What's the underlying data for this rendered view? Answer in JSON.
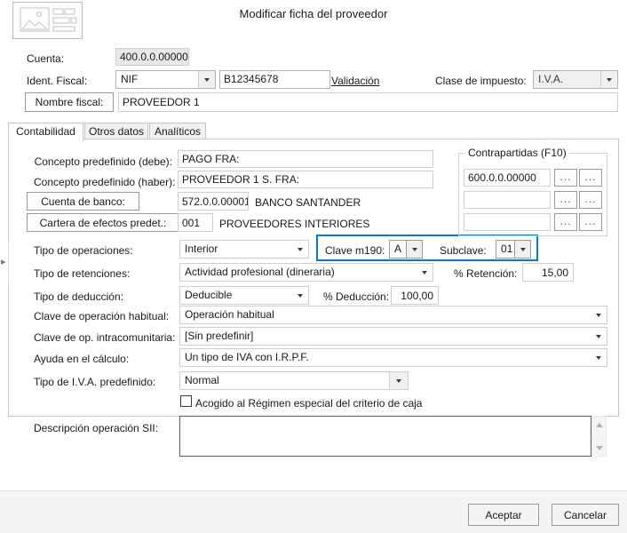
{
  "dialog": {
    "title": "Modificar ficha del proveedor",
    "header_icon": "image-placeholder-icon"
  },
  "header": {
    "cuenta_label": "Cuenta:",
    "cuenta_value": "400.0.0.00000",
    "ident_fiscal_label": "Ident. Fiscal:",
    "ident_fiscal_type": "NIF",
    "ident_fiscal_number": "B12345678",
    "validacion_link": "Validación",
    "clase_impuesto_label": "Clase de impuesto:",
    "clase_impuesto_value": "I.V.A.",
    "nombre_fiscal_button": "Nombre fiscal:",
    "nombre_fiscal_value": "PROVEEDOR 1"
  },
  "tabs": [
    {
      "label": "Contabilidad",
      "selected": true
    },
    {
      "label": "Otros datos",
      "selected": false
    },
    {
      "label": "Analíticos",
      "selected": false
    }
  ],
  "contabilidad": {
    "concepto_debe_label": "Concepto predefinido (debe):",
    "concepto_debe_value": "PAGO FRA:",
    "concepto_haber_label": "Concepto predefinido (haber):",
    "concepto_haber_value": "PROVEEDOR 1 S. FRA:",
    "cuenta_banco_button": "Cuenta de banco:",
    "cuenta_banco_code": "572.0.0.00001",
    "cuenta_banco_name": "BANCO SANTANDER",
    "cartera_button": "Cartera de efectos predet.:",
    "cartera_code": "001",
    "cartera_name": "PROVEEDORES INTERIORES",
    "tipo_operaciones_label": "Tipo de operaciones:",
    "tipo_operaciones_value": "Interior",
    "clave_m190_label": "Clave m190:",
    "clave_m190_value": "A",
    "subclave_label": "Subclave:",
    "subclave_value": "01",
    "tipo_retenciones_label": "Tipo de retenciones:",
    "tipo_retenciones_value": "Actividad profesional (dineraria)",
    "pct_retencion_label": "% Retención:",
    "pct_retencion_value": "15,00",
    "tipo_deduccion_label": "Tipo de deducción:",
    "tipo_deduccion_value": "Deducible",
    "pct_deduccion_label": "% Deducción:",
    "pct_deduccion_value": "100,00",
    "clave_op_habitual_label": "Clave de operación habitual:",
    "clave_op_habitual_value": "Operación habitual",
    "clave_op_intra_label": "Clave de op. intracomunitaria:",
    "clave_op_intra_value": "[Sin predefinir]",
    "ayuda_calculo_label": "Ayuda en el cálculo:",
    "ayuda_calculo_value": "Un tipo de IVA con I.R.P.F.",
    "tipo_iva_label": "Tipo de I.V.A. predefinido:",
    "tipo_iva_value": "Normal",
    "criterio_caja_label": "Acogido al Régimen especial del criterio de caja",
    "criterio_caja_checked": false,
    "descripcion_sii_label": "Descripción operación SII:",
    "descripcion_sii_value": ""
  },
  "contrapartidas": {
    "title": "Contrapartidas (F10)",
    "rows": [
      {
        "value": "600.0.0.00000",
        "btn1": "...",
        "btn2": "..."
      },
      {
        "value": "",
        "btn1": "...",
        "btn2": "..."
      },
      {
        "value": "",
        "btn1": "...",
        "btn2": "..."
      }
    ]
  },
  "footer": {
    "accept_label": "Aceptar",
    "cancel_label": "Cancelar"
  },
  "colors": {
    "highlight": "#0a7bc4",
    "dialog_bg": "#ffffff",
    "footer_bg": "#f4f4f4"
  }
}
